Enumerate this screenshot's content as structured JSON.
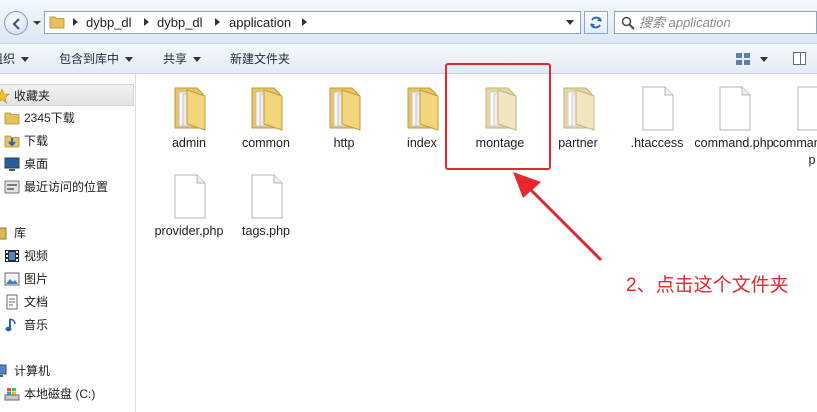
{
  "address_bar": {
    "breadcrumbs": [
      "dybp_dl",
      "dybp_dl",
      "application"
    ],
    "search_placeholder": "搜索 application"
  },
  "command_bar": {
    "organize": "组织",
    "include_in_library": "包含到库中",
    "share": "共享",
    "new_folder": "新建文件夹"
  },
  "sidebar": {
    "favorites": "收藏夹",
    "downloads_2345": "2345下载",
    "downloads": "下载",
    "desktop": "桌面",
    "recent": "最近访问的位置",
    "libraries": "库",
    "videos": "视频",
    "pictures": "图片",
    "documents": "文档",
    "music": "音乐",
    "computer": "计算机",
    "local_disk": "本地磁盘 (C:)"
  },
  "items": [
    {
      "name": "admin",
      "type": "folder"
    },
    {
      "name": "common",
      "type": "folder"
    },
    {
      "name": "http",
      "type": "folder"
    },
    {
      "name": "index",
      "type": "folder"
    },
    {
      "name": "montage",
      "type": "folder"
    },
    {
      "name": "partner",
      "type": "folder"
    },
    {
      "name": ".htaccess",
      "type": "file"
    },
    {
      "name": "command.php",
      "type": "file"
    },
    {
      "name": "commands.php",
      "type": "file"
    },
    {
      "name": "provider.php",
      "type": "file"
    },
    {
      "name": "tags.php",
      "type": "file"
    }
  ],
  "annotation": {
    "text": "2、点击这个文件夹",
    "color": "#e8262d",
    "target": "montage"
  }
}
